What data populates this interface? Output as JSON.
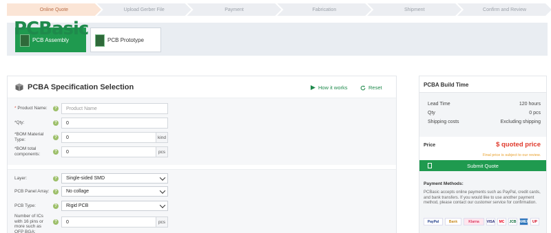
{
  "steps": [
    "Online Quote",
    "Upload Gerber File",
    "Payment",
    "Fabrication",
    "Shipment",
    "Confirm and Review"
  ],
  "brand": {
    "logo_text": "PCBasic"
  },
  "product_tabs": {
    "assembly": "PCB Assembly",
    "prototype": "PCB Prototype"
  },
  "spec": {
    "title": "PCBA Specification Selection",
    "how_it_works": "How it works",
    "reset": "Reset",
    "fields": {
      "product_name": {
        "label": "Product Name:",
        "placeholder": "Product Name"
      },
      "qty": {
        "label": "*Qty:",
        "value": "0"
      },
      "bom_type": {
        "label": "*BOM Material Type:",
        "value": "0",
        "unit": "kind"
      },
      "bom_total": {
        "label": "*BOM total components:",
        "value": "0",
        "unit": "pcs"
      },
      "layer": {
        "label": "Layer:",
        "value": "Single-sided SMD"
      },
      "panel_array": {
        "label": "PCB Panel Array:",
        "value": "No collage"
      },
      "pcb_type": {
        "label": "PCB Type:",
        "value": "Rigid PCB"
      },
      "ics": {
        "label": "Number of ICs with 16 pins or more such as QFP BGA:",
        "value": "0",
        "unit": "pcs"
      }
    }
  },
  "build": {
    "title": "PCBA Build Time",
    "lead_time_label": "Lead Time",
    "lead_time": "120 hours",
    "qty_label": "Qty",
    "qty": "0 pcs",
    "shipping_label": "Shipping costs",
    "shipping": "Excluding shipping",
    "price_label": "Price",
    "price": "$ quoted price",
    "price_note": "Final price is subject to our review.",
    "submit": "Submit Quote",
    "payment_title": "Payment Methods:",
    "payment_text": "PCBasic accepts online payments such as PayPal, credit cards, and bank transfers. If you would like to use another payment method, please contact our customer service for confirmation.",
    "payment_logos": [
      "PayPal",
      "Bank",
      "Klarna",
      "VISA",
      "MC",
      "JCB",
      "AMEX",
      "UP"
    ]
  },
  "colors": {
    "brand_green": "#1f9a4f",
    "price_red": "#e0392b",
    "active_step": "#fbe5d6"
  }
}
